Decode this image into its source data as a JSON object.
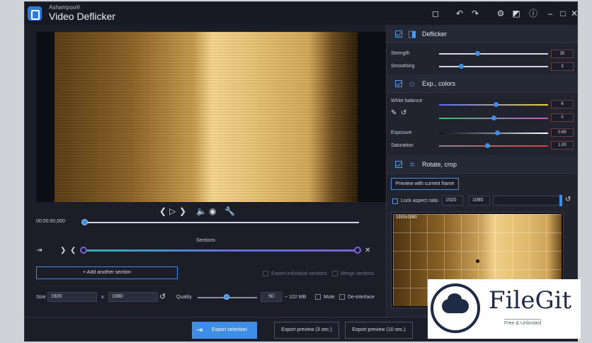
{
  "app": {
    "brand": "Ashampoo®",
    "title": "Video Deflicker"
  },
  "titlebar": {
    "icons": [
      "crop-frame-icon",
      "undo-icon",
      "redo-icon",
      "settings-icon",
      "theme-icon",
      "info-icon",
      "minimize-icon",
      "maximize-icon",
      "close-icon"
    ]
  },
  "player": {
    "timecode": "00:00:00,000",
    "playback_progress": 0
  },
  "sections": {
    "label": "Sections",
    "add_label": "+ Add another section",
    "export_individual_label": "Export individual sections",
    "merge_label": "Merge sections"
  },
  "output": {
    "size_label": "Size",
    "width": "1920",
    "x_sep": "x",
    "height": "1080",
    "quality_label": "Quality",
    "quality_value": "50",
    "size_estimate": "~ 102 MB",
    "mute_label": "Mute",
    "deinterlace_label": "De-interlace"
  },
  "footer": {
    "export_selection": "Export selection",
    "export_preview_3": "Export preview (3 sec.)",
    "export_preview_10": "Export preview (10 sec.)"
  },
  "panel": {
    "deflicker": {
      "title": "Deflicker",
      "strength_label": "Strength",
      "strength_value": "35",
      "strength_level": 0.35,
      "smoothing_label": "Smoothing",
      "smoothing_value": "3",
      "smoothing_level": 0.2
    },
    "colors": {
      "title": "Exp., colors",
      "white_balance_label": "White balance",
      "wb1_value": "6",
      "wb1_level": 0.52,
      "wb2_value": "0",
      "wb2_level": 0.5,
      "exposure_label": "Exposure",
      "exposure_value": "0.65",
      "exposure_level": 0.53,
      "saturation_label": "Saturation",
      "saturation_value": "1.00",
      "saturation_level": 0.44
    },
    "crop": {
      "title": "Rotate, crop",
      "preview_button": "Preview with current frame",
      "lock_label": "Lock aspect ratio",
      "width": "1920",
      "height": "1080",
      "dims_overlay": "1920x1080"
    }
  },
  "watermark": {
    "name": "FileGit",
    "tagline": "Free & Unlimited"
  },
  "colors": {
    "accent": "#3d8fe6",
    "background": "#1b1e29",
    "panel": "#21242f"
  }
}
